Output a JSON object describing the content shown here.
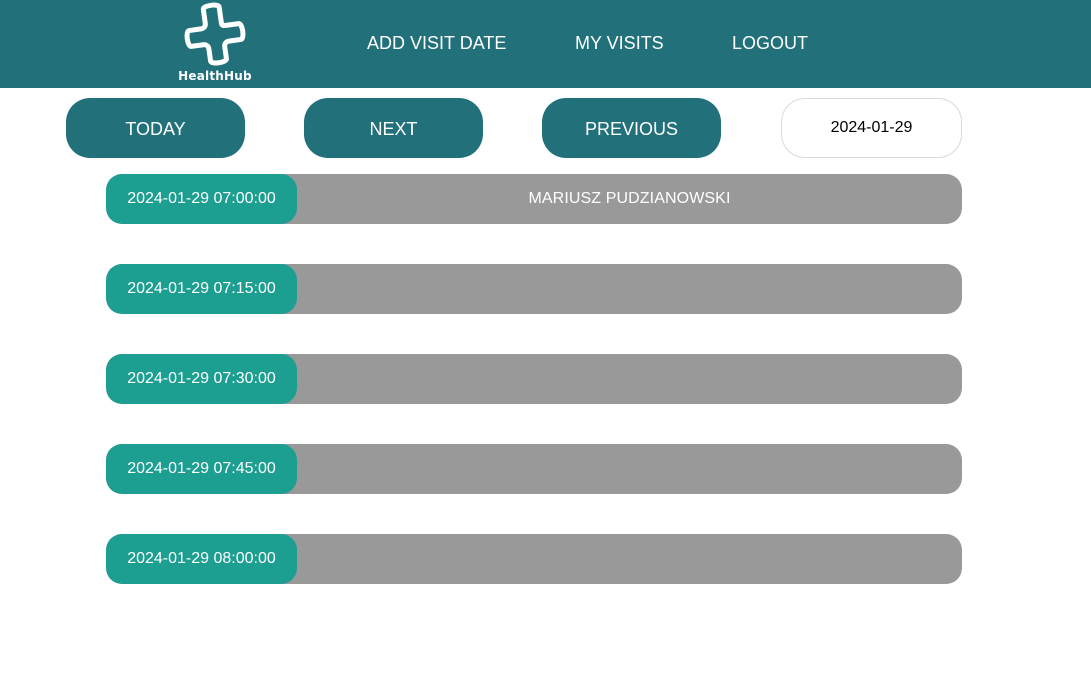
{
  "header": {
    "logo_text": "HealthHub",
    "nav": [
      {
        "label": "ADD VISIT DATE"
      },
      {
        "label": "MY VISITS"
      },
      {
        "label": "LOGOUT"
      }
    ]
  },
  "controls": {
    "today_label": "TODAY",
    "next_label": "NEXT",
    "previous_label": "PREVIOUS",
    "date_value": "2024-01-29"
  },
  "slots": [
    {
      "time": "2024-01-29 07:00:00",
      "patient": "MARIUSZ PUDZIANOWSKI"
    },
    {
      "time": "2024-01-29 07:15:00",
      "patient": ""
    },
    {
      "time": "2024-01-29 07:30:00",
      "patient": ""
    },
    {
      "time": "2024-01-29 07:45:00",
      "patient": ""
    },
    {
      "time": "2024-01-29 08:00:00",
      "patient": ""
    }
  ],
  "colors": {
    "header_bg": "#21707a",
    "button_bg": "#21707a",
    "slot_time_bg": "#1c9e91",
    "slot_bg": "#999999"
  },
  "icons": {
    "logo": "medical-cross-icon"
  }
}
